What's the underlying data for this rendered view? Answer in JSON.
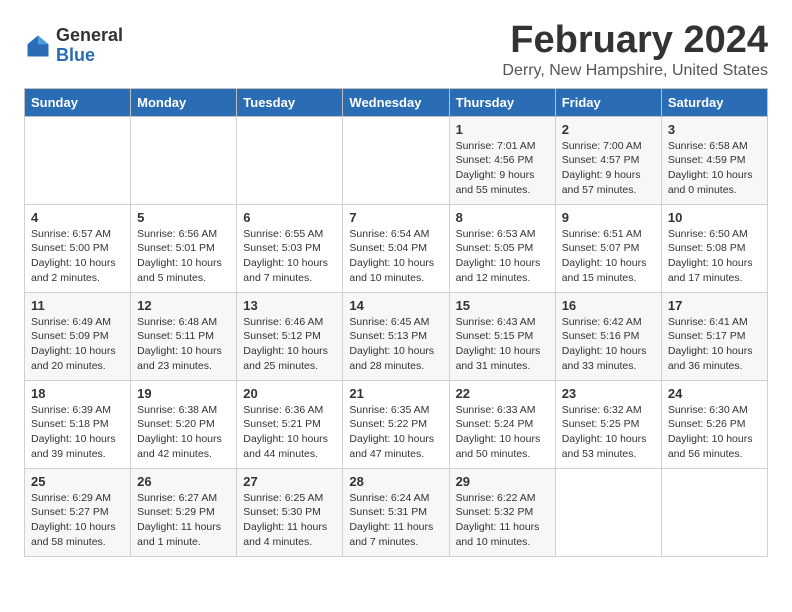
{
  "logo": {
    "general": "General",
    "blue": "Blue"
  },
  "header": {
    "month": "February 2024",
    "location": "Derry, New Hampshire, United States"
  },
  "weekdays": [
    "Sunday",
    "Monday",
    "Tuesday",
    "Wednesday",
    "Thursday",
    "Friday",
    "Saturday"
  ],
  "weeks": [
    [
      {
        "day": "",
        "info": ""
      },
      {
        "day": "",
        "info": ""
      },
      {
        "day": "",
        "info": ""
      },
      {
        "day": "",
        "info": ""
      },
      {
        "day": "1",
        "info": "Sunrise: 7:01 AM\nSunset: 4:56 PM\nDaylight: 9 hours\nand 55 minutes."
      },
      {
        "day": "2",
        "info": "Sunrise: 7:00 AM\nSunset: 4:57 PM\nDaylight: 9 hours\nand 57 minutes."
      },
      {
        "day": "3",
        "info": "Sunrise: 6:58 AM\nSunset: 4:59 PM\nDaylight: 10 hours\nand 0 minutes."
      }
    ],
    [
      {
        "day": "4",
        "info": "Sunrise: 6:57 AM\nSunset: 5:00 PM\nDaylight: 10 hours\nand 2 minutes."
      },
      {
        "day": "5",
        "info": "Sunrise: 6:56 AM\nSunset: 5:01 PM\nDaylight: 10 hours\nand 5 minutes."
      },
      {
        "day": "6",
        "info": "Sunrise: 6:55 AM\nSunset: 5:03 PM\nDaylight: 10 hours\nand 7 minutes."
      },
      {
        "day": "7",
        "info": "Sunrise: 6:54 AM\nSunset: 5:04 PM\nDaylight: 10 hours\nand 10 minutes."
      },
      {
        "day": "8",
        "info": "Sunrise: 6:53 AM\nSunset: 5:05 PM\nDaylight: 10 hours\nand 12 minutes."
      },
      {
        "day": "9",
        "info": "Sunrise: 6:51 AM\nSunset: 5:07 PM\nDaylight: 10 hours\nand 15 minutes."
      },
      {
        "day": "10",
        "info": "Sunrise: 6:50 AM\nSunset: 5:08 PM\nDaylight: 10 hours\nand 17 minutes."
      }
    ],
    [
      {
        "day": "11",
        "info": "Sunrise: 6:49 AM\nSunset: 5:09 PM\nDaylight: 10 hours\nand 20 minutes."
      },
      {
        "day": "12",
        "info": "Sunrise: 6:48 AM\nSunset: 5:11 PM\nDaylight: 10 hours\nand 23 minutes."
      },
      {
        "day": "13",
        "info": "Sunrise: 6:46 AM\nSunset: 5:12 PM\nDaylight: 10 hours\nand 25 minutes."
      },
      {
        "day": "14",
        "info": "Sunrise: 6:45 AM\nSunset: 5:13 PM\nDaylight: 10 hours\nand 28 minutes."
      },
      {
        "day": "15",
        "info": "Sunrise: 6:43 AM\nSunset: 5:15 PM\nDaylight: 10 hours\nand 31 minutes."
      },
      {
        "day": "16",
        "info": "Sunrise: 6:42 AM\nSunset: 5:16 PM\nDaylight: 10 hours\nand 33 minutes."
      },
      {
        "day": "17",
        "info": "Sunrise: 6:41 AM\nSunset: 5:17 PM\nDaylight: 10 hours\nand 36 minutes."
      }
    ],
    [
      {
        "day": "18",
        "info": "Sunrise: 6:39 AM\nSunset: 5:18 PM\nDaylight: 10 hours\nand 39 minutes."
      },
      {
        "day": "19",
        "info": "Sunrise: 6:38 AM\nSunset: 5:20 PM\nDaylight: 10 hours\nand 42 minutes."
      },
      {
        "day": "20",
        "info": "Sunrise: 6:36 AM\nSunset: 5:21 PM\nDaylight: 10 hours\nand 44 minutes."
      },
      {
        "day": "21",
        "info": "Sunrise: 6:35 AM\nSunset: 5:22 PM\nDaylight: 10 hours\nand 47 minutes."
      },
      {
        "day": "22",
        "info": "Sunrise: 6:33 AM\nSunset: 5:24 PM\nDaylight: 10 hours\nand 50 minutes."
      },
      {
        "day": "23",
        "info": "Sunrise: 6:32 AM\nSunset: 5:25 PM\nDaylight: 10 hours\nand 53 minutes."
      },
      {
        "day": "24",
        "info": "Sunrise: 6:30 AM\nSunset: 5:26 PM\nDaylight: 10 hours\nand 56 minutes."
      }
    ],
    [
      {
        "day": "25",
        "info": "Sunrise: 6:29 AM\nSunset: 5:27 PM\nDaylight: 10 hours\nand 58 minutes."
      },
      {
        "day": "26",
        "info": "Sunrise: 6:27 AM\nSunset: 5:29 PM\nDaylight: 11 hours\nand 1 minute."
      },
      {
        "day": "27",
        "info": "Sunrise: 6:25 AM\nSunset: 5:30 PM\nDaylight: 11 hours\nand 4 minutes."
      },
      {
        "day": "28",
        "info": "Sunrise: 6:24 AM\nSunset: 5:31 PM\nDaylight: 11 hours\nand 7 minutes."
      },
      {
        "day": "29",
        "info": "Sunrise: 6:22 AM\nSunset: 5:32 PM\nDaylight: 11 hours\nand 10 minutes."
      },
      {
        "day": "",
        "info": ""
      },
      {
        "day": "",
        "info": ""
      }
    ]
  ]
}
